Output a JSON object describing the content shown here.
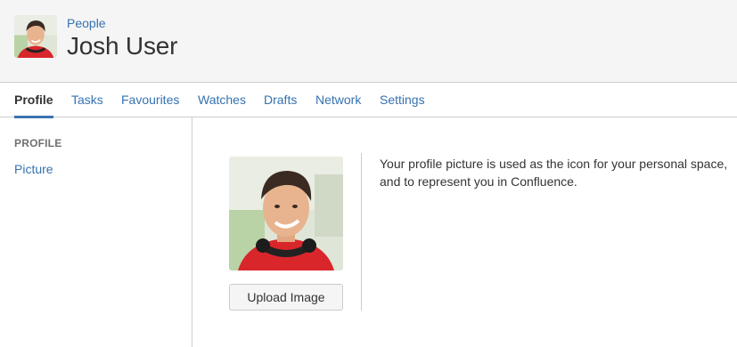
{
  "header": {
    "breadcrumb": "People",
    "title": "Josh User",
    "avatar_icon": "user-avatar-photo"
  },
  "tabs": [
    {
      "label": "Profile",
      "active": true
    },
    {
      "label": "Tasks",
      "active": false
    },
    {
      "label": "Favourites",
      "active": false
    },
    {
      "label": "Watches",
      "active": false
    },
    {
      "label": "Drafts",
      "active": false
    },
    {
      "label": "Network",
      "active": false
    },
    {
      "label": "Settings",
      "active": false
    }
  ],
  "sidebar": {
    "heading": "PROFILE",
    "items": [
      {
        "label": "Picture"
      }
    ]
  },
  "main": {
    "upload_button": "Upload Image",
    "description": "Your profile picture is used as the icon for your personal space, and to represent you in Confluence."
  },
  "colors": {
    "link": "#3572b0",
    "active_tab_underline": "#3b73af",
    "header_bg": "#f5f5f5",
    "border": "#cccccc"
  }
}
